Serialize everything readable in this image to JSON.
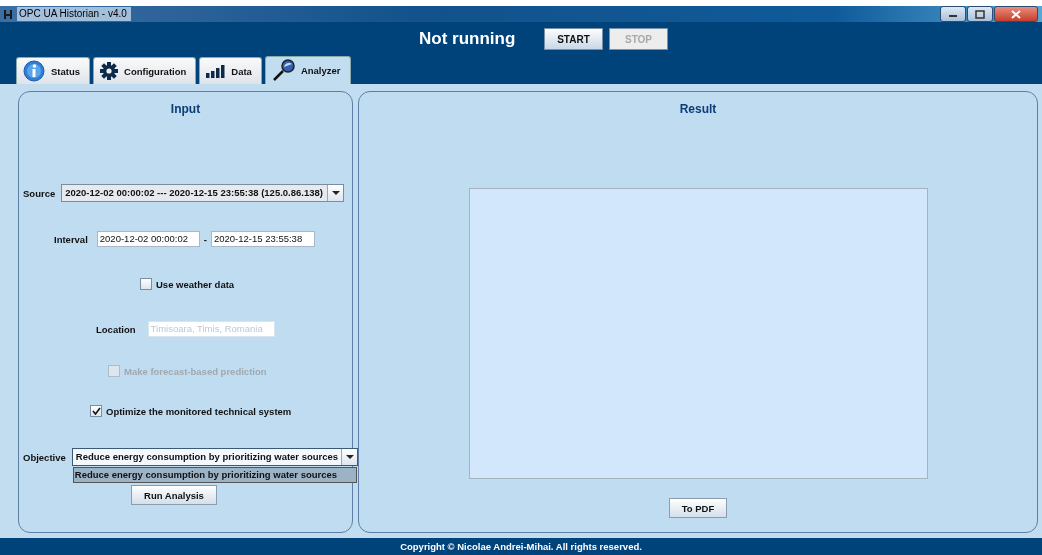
{
  "window": {
    "title": "OPC UA Historian - v4.0"
  },
  "header": {
    "status": "Not running",
    "buttons": [
      {
        "label": "START",
        "disabled": false
      },
      {
        "label": "STOP",
        "disabled": true
      }
    ]
  },
  "tabs": [
    {
      "label": "Status",
      "kind": "info",
      "selected": false
    },
    {
      "label": "Configuration",
      "kind": "gear",
      "selected": false
    },
    {
      "label": "Data",
      "kind": "bars",
      "selected": false
    },
    {
      "label": "Analyzer",
      "kind": "magnifier",
      "selected": true
    }
  ],
  "input": {
    "title": "Input",
    "source": {
      "label": "Source",
      "value": "2020-12-02 00:00:02 --- 2020-12-15 23:55:38 (125.0.86.138)"
    },
    "interval": {
      "label": "Interval",
      "from": "2020-12-02 00:00:02",
      "separator": "-",
      "to": "2020-12-15 23:55:38"
    },
    "use_weather": {
      "label": "Use weather data",
      "checked": false,
      "disabled": false
    },
    "location": {
      "label": "Location",
      "value": "Timisoara, Timis, Romania",
      "disabled": true
    },
    "forecast": {
      "label": "Make forecast-based prediction",
      "checked": false,
      "disabled": true
    },
    "optimize": {
      "label": "Optimize the monitored technical system",
      "checked": true,
      "disabled": false
    },
    "objective": {
      "label": "Objective",
      "value": "Reduce energy consumption by prioritizing water sources",
      "expanded": true,
      "options": [
        {
          "label": "Reduce energy consumption by prioritizing water sources",
          "selected": true
        }
      ]
    },
    "run_button": "Run Analysis"
  },
  "result": {
    "title": "Result",
    "pdf_button": "To PDF"
  },
  "footer": {
    "text": "Copyright © Nicolae Andrei-Mihai. All rights reserved."
  }
}
